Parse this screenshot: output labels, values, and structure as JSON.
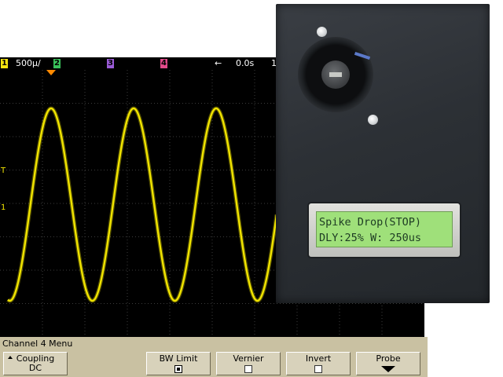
{
  "header": {
    "ch1_num": "1",
    "ch1_scale": "500μ/",
    "ch2_num": "2",
    "ch3_num": "3",
    "ch4_num": "4",
    "arrow": "←",
    "time": "0.0s",
    "trailing": "1",
    "colors": {
      "ch1": "#f5e40f",
      "ch2": "#39c15a",
      "ch3": "#9a5bd6",
      "ch4": "#e24a8a",
      "trigger": "#ff8a00"
    }
  },
  "scope": {
    "trace_color": "#f1e400",
    "markers": {
      "trigger_level": "T",
      "channel_ground": "1"
    }
  },
  "device": {
    "lcd_line1": "Spike Drop(STOP)",
    "lcd_line2": "DLY:25% W: 250us"
  },
  "menu": {
    "title": "Channel 4  Menu",
    "coupling_label": "Coupling",
    "coupling_value": "DC",
    "bw_label": "BW Limit",
    "vernier_label": "Vernier",
    "invert_label": "Invert",
    "probe_label": "Probe",
    "bw_checked": true,
    "vernier_checked": false,
    "invert_checked": false,
    "icons": {
      "coupling": "up-arrow-icon",
      "probe": "down-arrow-icon"
    }
  }
}
